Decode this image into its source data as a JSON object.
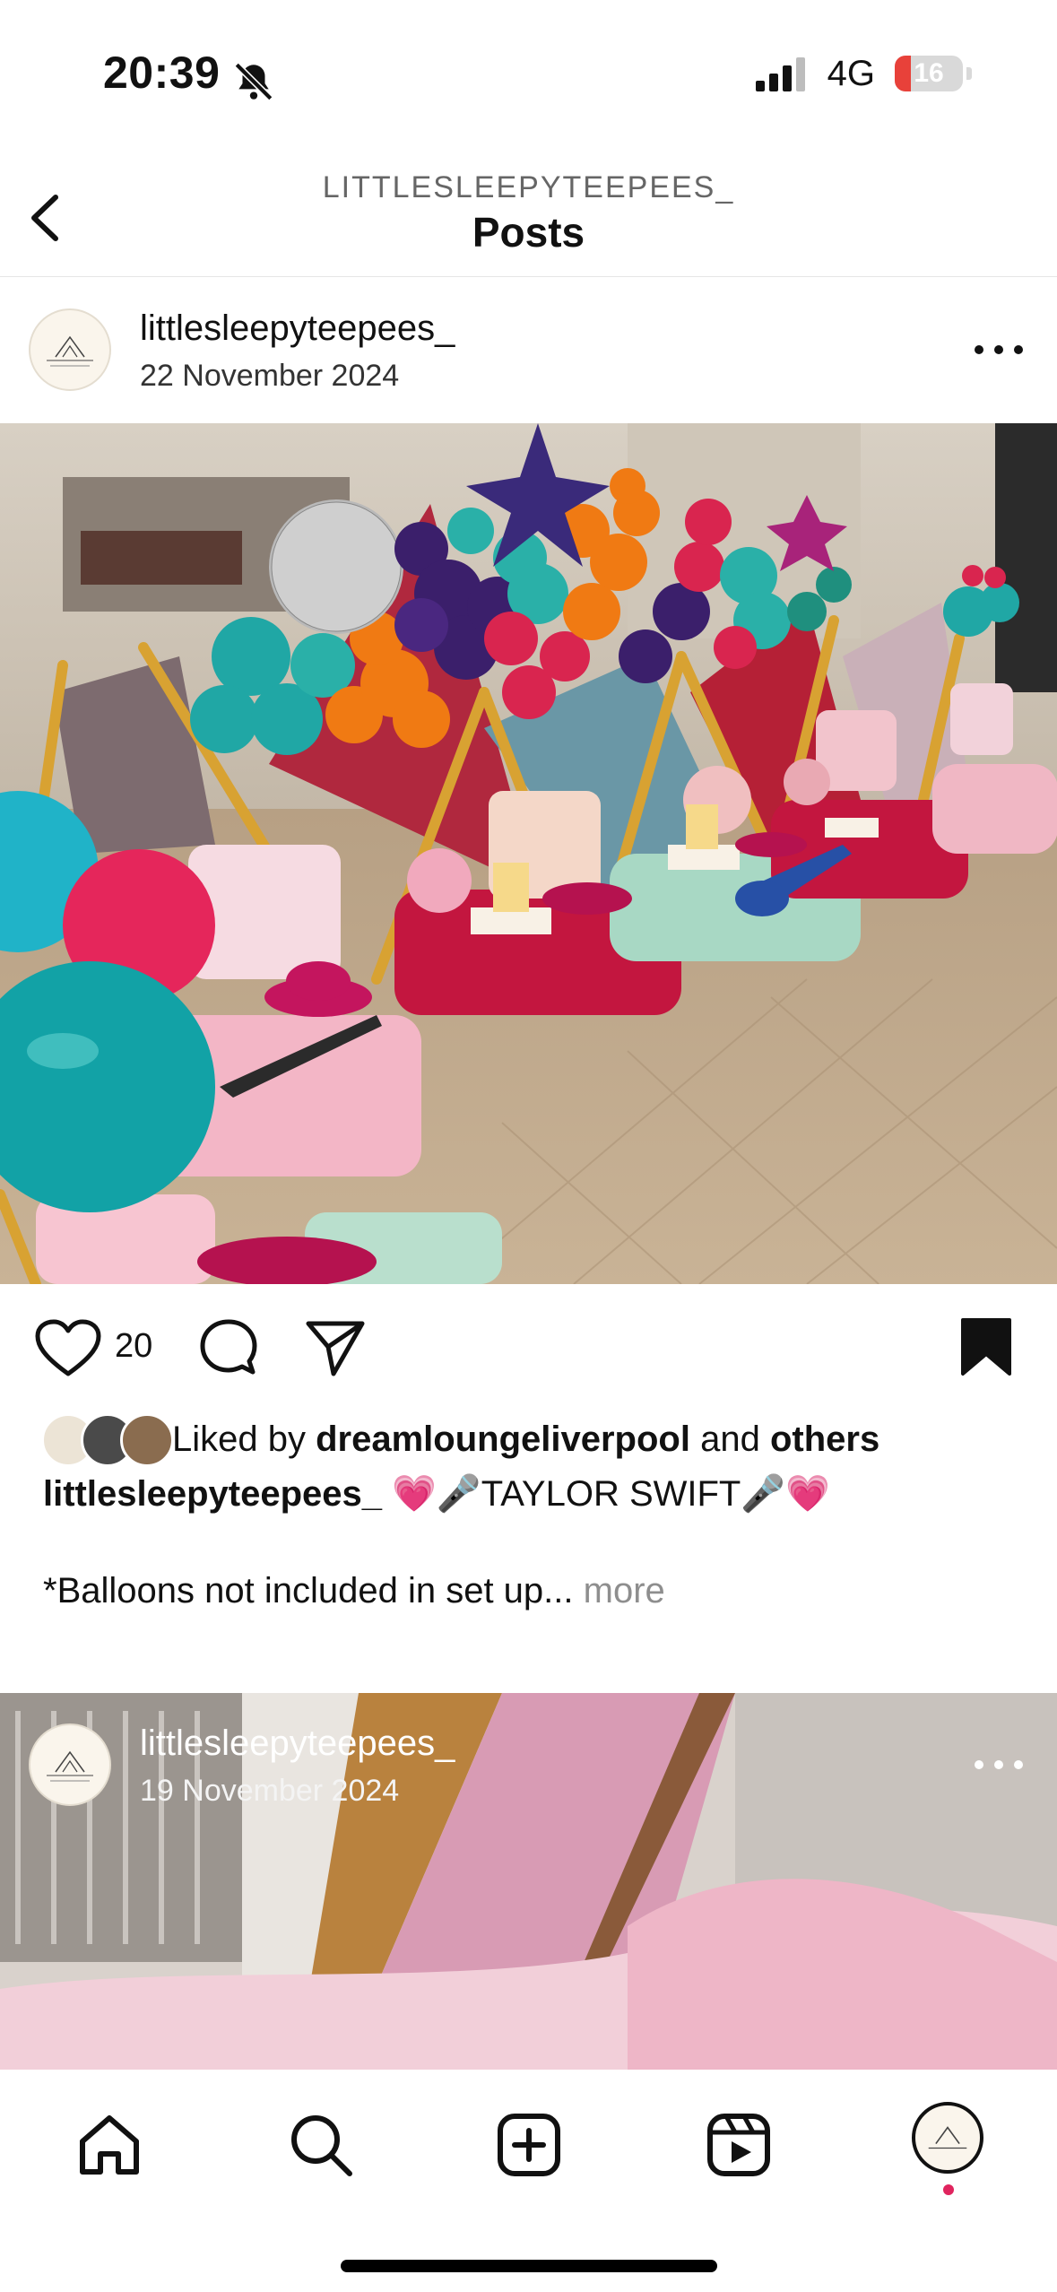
{
  "status": {
    "time": "20:39",
    "network": "4G",
    "battery": "16"
  },
  "header": {
    "subtitle": "LITTLESLEEPYTEEPEES_",
    "title": "Posts"
  },
  "post1": {
    "username": "littlesleepyteepees_",
    "date": "22 November 2024",
    "like_count": "20",
    "liked_by_prefix": "Liked by ",
    "liked_by_user": "dreamloungeliverpool",
    "liked_by_and": " and ",
    "liked_by_others": "others",
    "caption_user": "littlesleepyteepees_",
    "caption_text": " 💗🎤TAYLOR SWIFT🎤💗",
    "caption_line2": "*Balloons not included in set up...",
    "more_label": " more"
  },
  "post2": {
    "username": "littlesleepyteepees_",
    "date": "19 November 2024"
  },
  "colors": {
    "accent_red": "#e0245e",
    "battery_red": "#e8413a"
  },
  "nav": {
    "items": [
      "home-icon",
      "search-icon",
      "create-icon",
      "reels-icon",
      "profile-avatar"
    ]
  }
}
